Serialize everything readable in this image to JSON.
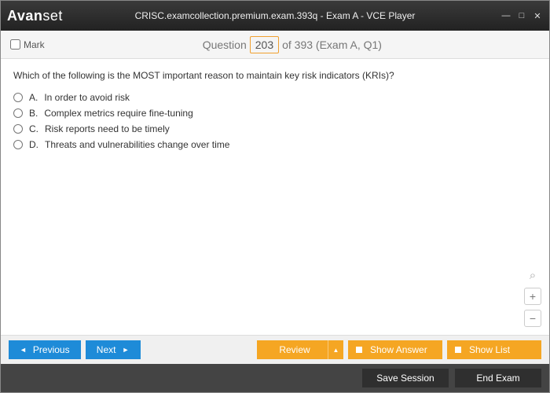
{
  "window": {
    "logo_a": "Avan",
    "logo_b": "set",
    "title": "CRISC.examcollection.premium.exam.393q - Exam A - VCE Player"
  },
  "subheader": {
    "mark_label": "Mark",
    "question_label": "Question",
    "current_num": "203",
    "total_info": "of 393 (Exam A, Q1)"
  },
  "question": {
    "text": "Which of the following is the MOST important reason to maintain key risk indicators (KRIs)?",
    "options": [
      {
        "letter": "A.",
        "text": "In order to avoid risk"
      },
      {
        "letter": "B.",
        "text": "Complex metrics require fine-tuning"
      },
      {
        "letter": "C.",
        "text": "Risk reports need to be timely"
      },
      {
        "letter": "D.",
        "text": "Threats and vulnerabilities change over time"
      }
    ]
  },
  "tools": {
    "zoom": "⌕",
    "plus": "+",
    "minus": "−"
  },
  "footer1": {
    "previous": "Previous",
    "next": "Next",
    "review": "Review",
    "show_answer": "Show Answer",
    "show_list": "Show List"
  },
  "footer2": {
    "save_session": "Save Session",
    "end_exam": "End Exam"
  }
}
